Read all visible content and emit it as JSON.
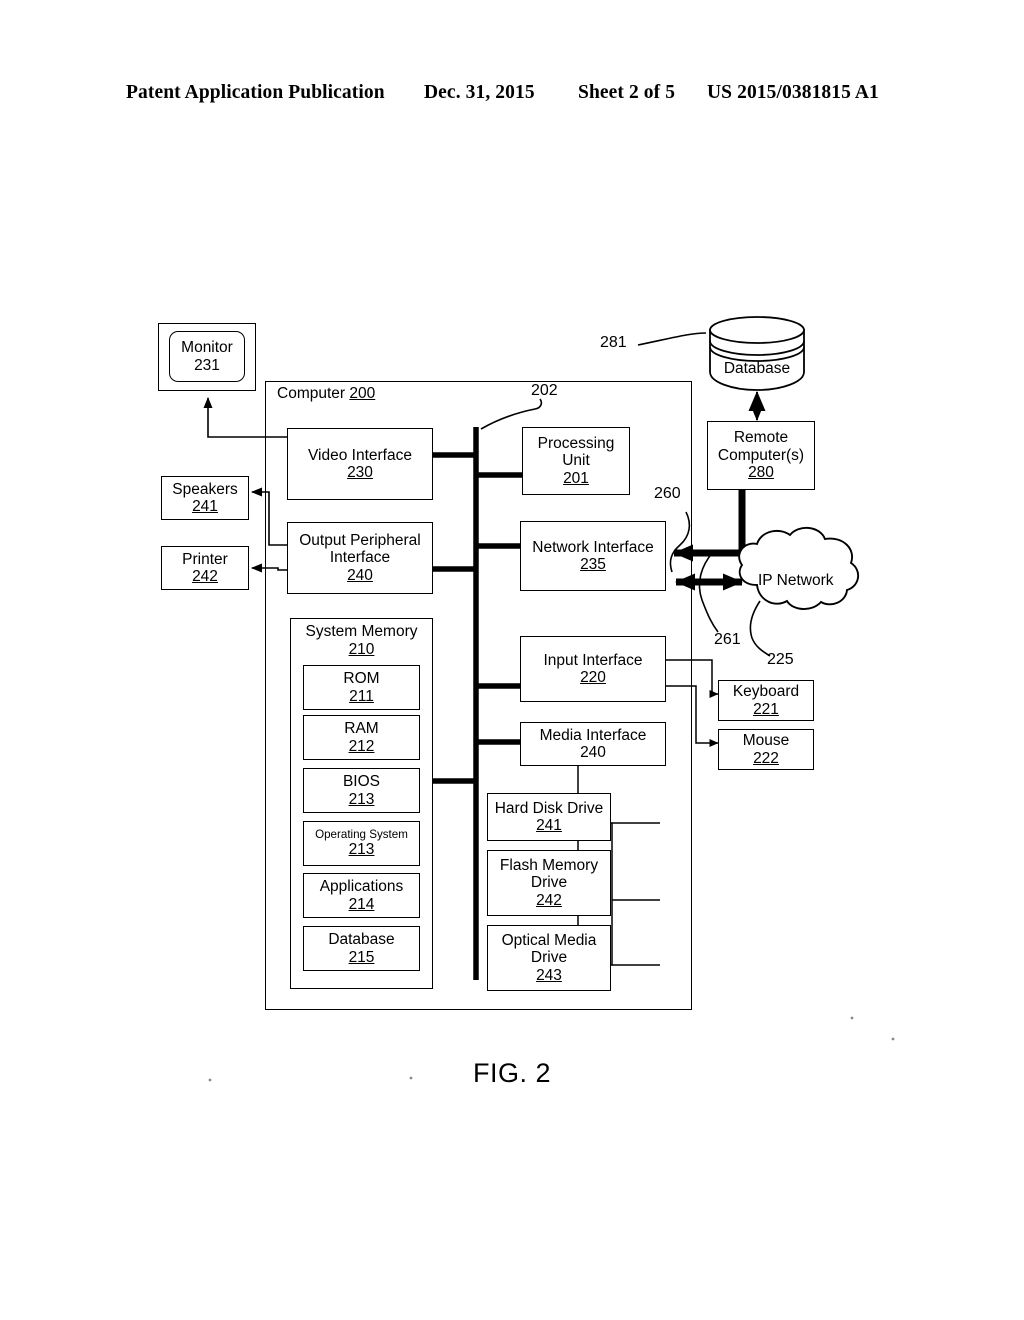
{
  "header": {
    "publication": "Patent Application Publication",
    "date": "Dec. 31, 2015",
    "sheet": "Sheet 2 of 5",
    "number": "US 2015/0381815 A1"
  },
  "figure": {
    "caption": "FIG. 2",
    "container": {
      "label": "Computer",
      "ref": "200"
    },
    "bus_ref": "202",
    "nodes": {
      "monitor": {
        "label": "Monitor",
        "ref": "231"
      },
      "speakers": {
        "label": "Speakers",
        "ref": "241"
      },
      "printer": {
        "label": "Printer",
        "ref": "242"
      },
      "video_interface": {
        "label": "Video Interface",
        "ref": "230"
      },
      "output_peripheral_interface": {
        "label": "Output Peripheral Interface",
        "ref": "240"
      },
      "system_memory": {
        "label": "System Memory",
        "ref": "210"
      },
      "rom": {
        "label": "ROM",
        "ref": "211"
      },
      "ram": {
        "label": "RAM",
        "ref": "212"
      },
      "bios": {
        "label": "BIOS",
        "ref": "213"
      },
      "operating_system": {
        "label": "Operating System",
        "ref": "213"
      },
      "applications": {
        "label": "Applications",
        "ref": "214"
      },
      "memory_database": {
        "label": "Database",
        "ref": "215"
      },
      "processing_unit": {
        "label": "Processing Unit",
        "ref": "201"
      },
      "network_interface": {
        "label": "Network Interface",
        "ref": "235"
      },
      "input_interface": {
        "label": "Input Interface",
        "ref": "220"
      },
      "media_interface": {
        "label": "Media Interface",
        "ref": "240"
      },
      "hard_disk_drive": {
        "label": "Hard Disk Drive",
        "ref": "241"
      },
      "flash_memory_drive": {
        "label": "Flash Memory Drive",
        "ref": "242"
      },
      "optical_media_drive": {
        "label": "Optical Media Drive",
        "ref": "243"
      },
      "keyboard": {
        "label": "Keyboard",
        "ref": "221"
      },
      "mouse": {
        "label": "Mouse",
        "ref": "222"
      },
      "remote_computers": {
        "label": "Remote Computer(s)",
        "ref": "280"
      },
      "database": {
        "label": "Database",
        "ref": "281"
      },
      "ip_network": {
        "label": "IP Network",
        "ref": "225"
      }
    },
    "leaders": {
      "db_281": "281",
      "net_260": "260",
      "net_261": "261",
      "cloud_225": "225",
      "bus_202": "202"
    }
  }
}
